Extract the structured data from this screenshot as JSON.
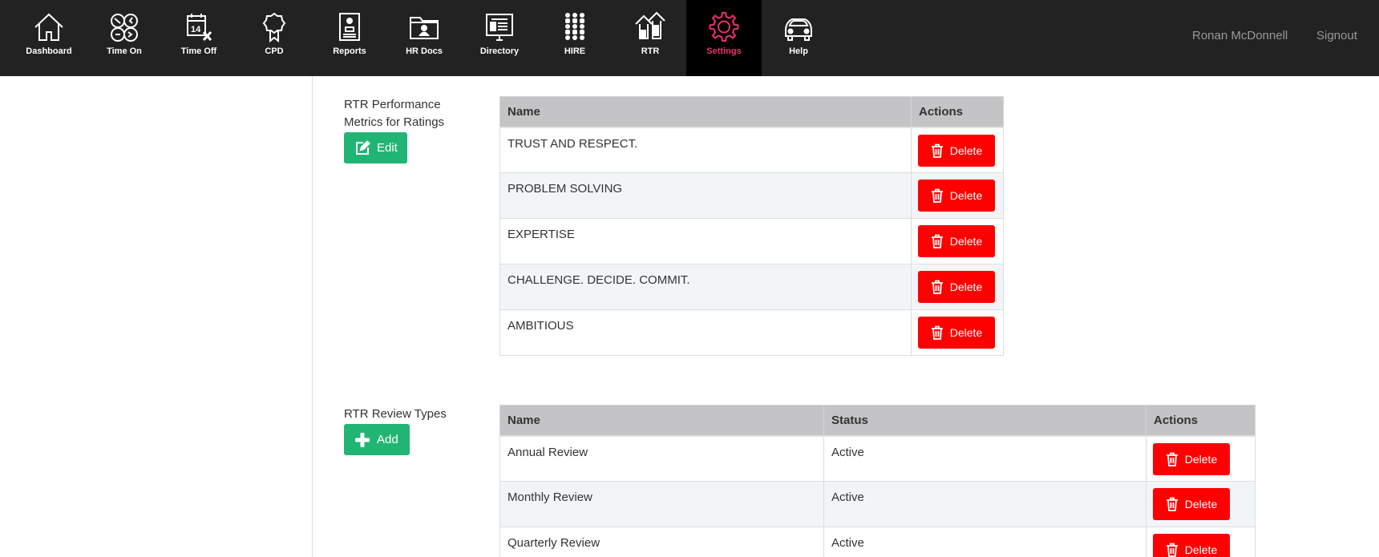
{
  "nav": {
    "items": [
      {
        "id": "dashboard",
        "label": "Dashboard",
        "icon": "house-icon"
      },
      {
        "id": "time-on",
        "label": "Time On",
        "icon": "clocks-icon"
      },
      {
        "id": "time-off",
        "label": "Time Off",
        "icon": "calendar-icon",
        "icon_text": "14"
      },
      {
        "id": "cpd",
        "label": "CPD",
        "icon": "award-ribbon-icon"
      },
      {
        "id": "reports",
        "label": "Reports",
        "icon": "report-icon"
      },
      {
        "id": "hr-docs",
        "label": "HR Docs",
        "icon": "folder-icon"
      },
      {
        "id": "directory",
        "label": "Directory",
        "icon": "directory-icon"
      },
      {
        "id": "hire",
        "label": "HIRE",
        "icon": "people-grid-icon"
      },
      {
        "id": "rtr",
        "label": "RTR",
        "icon": "upward-arrows-icon"
      },
      {
        "id": "settings",
        "label": "Settings",
        "icon": "gear-icon",
        "active": true
      },
      {
        "id": "help",
        "label": "Help",
        "icon": "car-icon"
      }
    ],
    "active_color": "#e8336d",
    "user_name": "Ronan McDonnell",
    "signout_label": "Signout"
  },
  "metrics_section": {
    "label": "RTR Performance Metrics for Ratings",
    "edit_label": "Edit",
    "table": {
      "headers": [
        "Name",
        "Actions"
      ],
      "rows": [
        {
          "name": "TRUST AND RESPECT.",
          "action": "Delete"
        },
        {
          "name": "PROBLEM SOLVING",
          "action": "Delete"
        },
        {
          "name": "EXPERTISE",
          "action": "Delete"
        },
        {
          "name": "CHALLENGE. DECIDE. COMMIT.",
          "action": "Delete"
        },
        {
          "name": "AMBITIOUS",
          "action": "Delete"
        }
      ]
    }
  },
  "review_section": {
    "label": "RTR Review Types",
    "add_label": "Add",
    "table": {
      "headers": [
        "Name",
        "Status",
        "Actions"
      ],
      "rows": [
        {
          "name": "Annual Review",
          "status": "Active",
          "action": "Delete"
        },
        {
          "name": "Monthly Review",
          "status": "Active",
          "action": "Delete"
        },
        {
          "name": "Quarterly Review",
          "status": "Active",
          "action": "Delete"
        }
      ]
    }
  },
  "colors": {
    "nav_bg": "#222222",
    "add_button": "#21b573",
    "delete_button": "#ff0000",
    "table_header": "#c4c4c6"
  }
}
